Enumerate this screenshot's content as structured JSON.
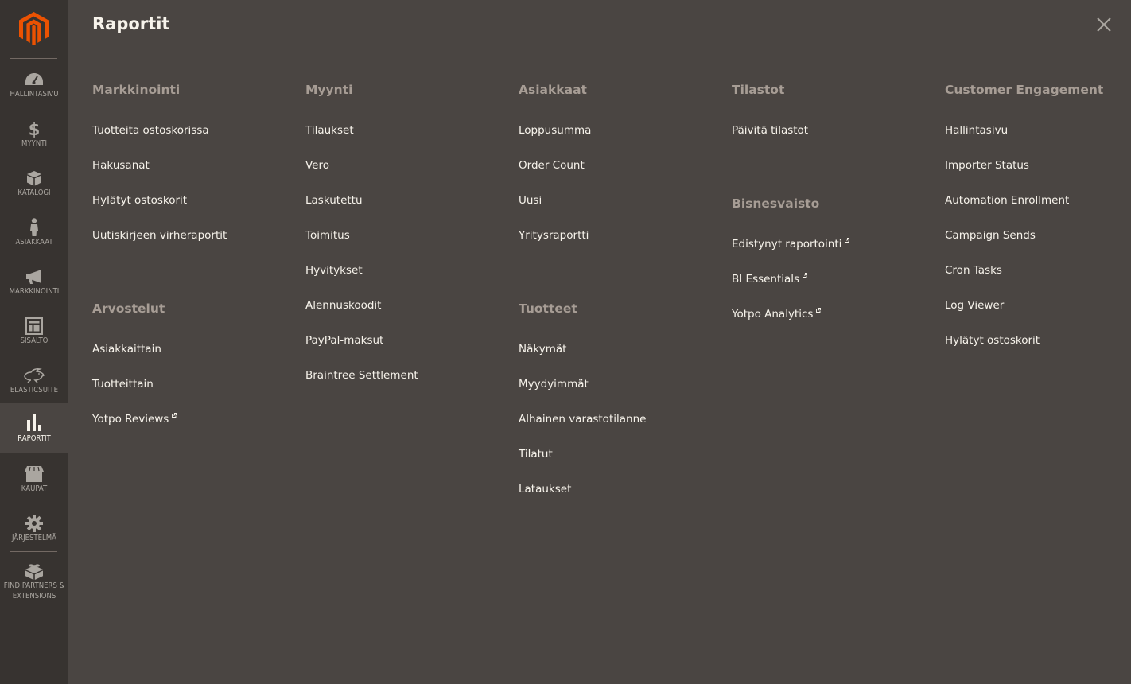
{
  "brand": {
    "logo": "magento-logo-icon",
    "accent": "#eb5202"
  },
  "sidebar": {
    "items": [
      {
        "label": "Hallintasivu",
        "icon": "dashboard-icon",
        "active": false
      },
      {
        "label": "Myynti",
        "icon": "dollar-icon",
        "active": false
      },
      {
        "label": "Katalogi",
        "icon": "box-icon",
        "active": false
      },
      {
        "label": "Asiakkaat",
        "icon": "person-icon",
        "active": false
      },
      {
        "label": "Markkinointi",
        "icon": "megaphone-icon",
        "active": false
      },
      {
        "label": "Sisältö",
        "icon": "layout-icon",
        "active": false
      },
      {
        "label": "Elasticsuite",
        "icon": "rabbit-icon",
        "active": false
      },
      {
        "label": "Raportit",
        "icon": "bar-chart-icon",
        "active": true
      },
      {
        "label": "Kaupat",
        "icon": "store-icon",
        "active": false
      },
      {
        "label": "Järjestelmä",
        "icon": "gear-icon",
        "active": false
      },
      {
        "label": "Find Partners & Extensions",
        "icon": "lego-brick-icon",
        "active": false
      }
    ]
  },
  "panel": {
    "title": "Raportit",
    "close_icon": "close-icon",
    "groups": [
      {
        "title": "Markkinointi",
        "items": [
          {
            "label": "Tuotteita ostoskorissa",
            "external": false
          },
          {
            "label": "Hakusanat",
            "external": false
          },
          {
            "label": "Hylätyt ostoskorit",
            "external": false
          },
          {
            "label": "Uutiskirjeen virheraportit",
            "external": false
          }
        ]
      },
      {
        "title": "Arvostelut",
        "items": [
          {
            "label": "Asiakkaittain",
            "external": false
          },
          {
            "label": "Tuotteittain",
            "external": false
          },
          {
            "label": "Yotpo Reviews",
            "external": true
          }
        ]
      },
      {
        "title": "Myynti",
        "items": [
          {
            "label": "Tilaukset",
            "external": false
          },
          {
            "label": "Vero",
            "external": false
          },
          {
            "label": "Laskutettu",
            "external": false
          },
          {
            "label": "Toimitus",
            "external": false
          },
          {
            "label": "Hyvitykset",
            "external": false
          },
          {
            "label": "Alennuskoodit",
            "external": false
          },
          {
            "label": "PayPal-maksut",
            "external": false
          },
          {
            "label": "Braintree Settlement",
            "external": false
          }
        ]
      },
      {
        "title": "Asiakkaat",
        "items": [
          {
            "label": "Loppusumma",
            "external": false
          },
          {
            "label": "Order Count",
            "external": false
          },
          {
            "label": "Uusi",
            "external": false
          },
          {
            "label": "Yritysraportti",
            "external": false
          }
        ]
      },
      {
        "title": "Tuotteet",
        "items": [
          {
            "label": "Näkymät",
            "external": false
          },
          {
            "label": "Myydyimmät",
            "external": false
          },
          {
            "label": "Alhainen varastotilanne",
            "external": false
          },
          {
            "label": "Tilatut",
            "external": false
          },
          {
            "label": "Lataukset",
            "external": false
          }
        ]
      },
      {
        "title": "Tilastot",
        "items": [
          {
            "label": "Päivitä tilastot",
            "external": false
          }
        ]
      },
      {
        "title": "Bisnesvaisto",
        "items": [
          {
            "label": "Edistynyt raportointi",
            "external": true
          },
          {
            "label": "BI Essentials",
            "external": true
          },
          {
            "label": "Yotpo Analytics",
            "external": true
          }
        ]
      },
      {
        "title": "Customer Engagement",
        "items": [
          {
            "label": "Hallintasivu",
            "external": false
          },
          {
            "label": "Importer Status",
            "external": false
          },
          {
            "label": "Automation Enrollment",
            "external": false
          },
          {
            "label": "Campaign Sends",
            "external": false
          },
          {
            "label": "Cron Tasks",
            "external": false
          },
          {
            "label": "Log Viewer",
            "external": false
          },
          {
            "label": "Hylätyt ostoskorit",
            "external": false
          }
        ]
      }
    ]
  }
}
